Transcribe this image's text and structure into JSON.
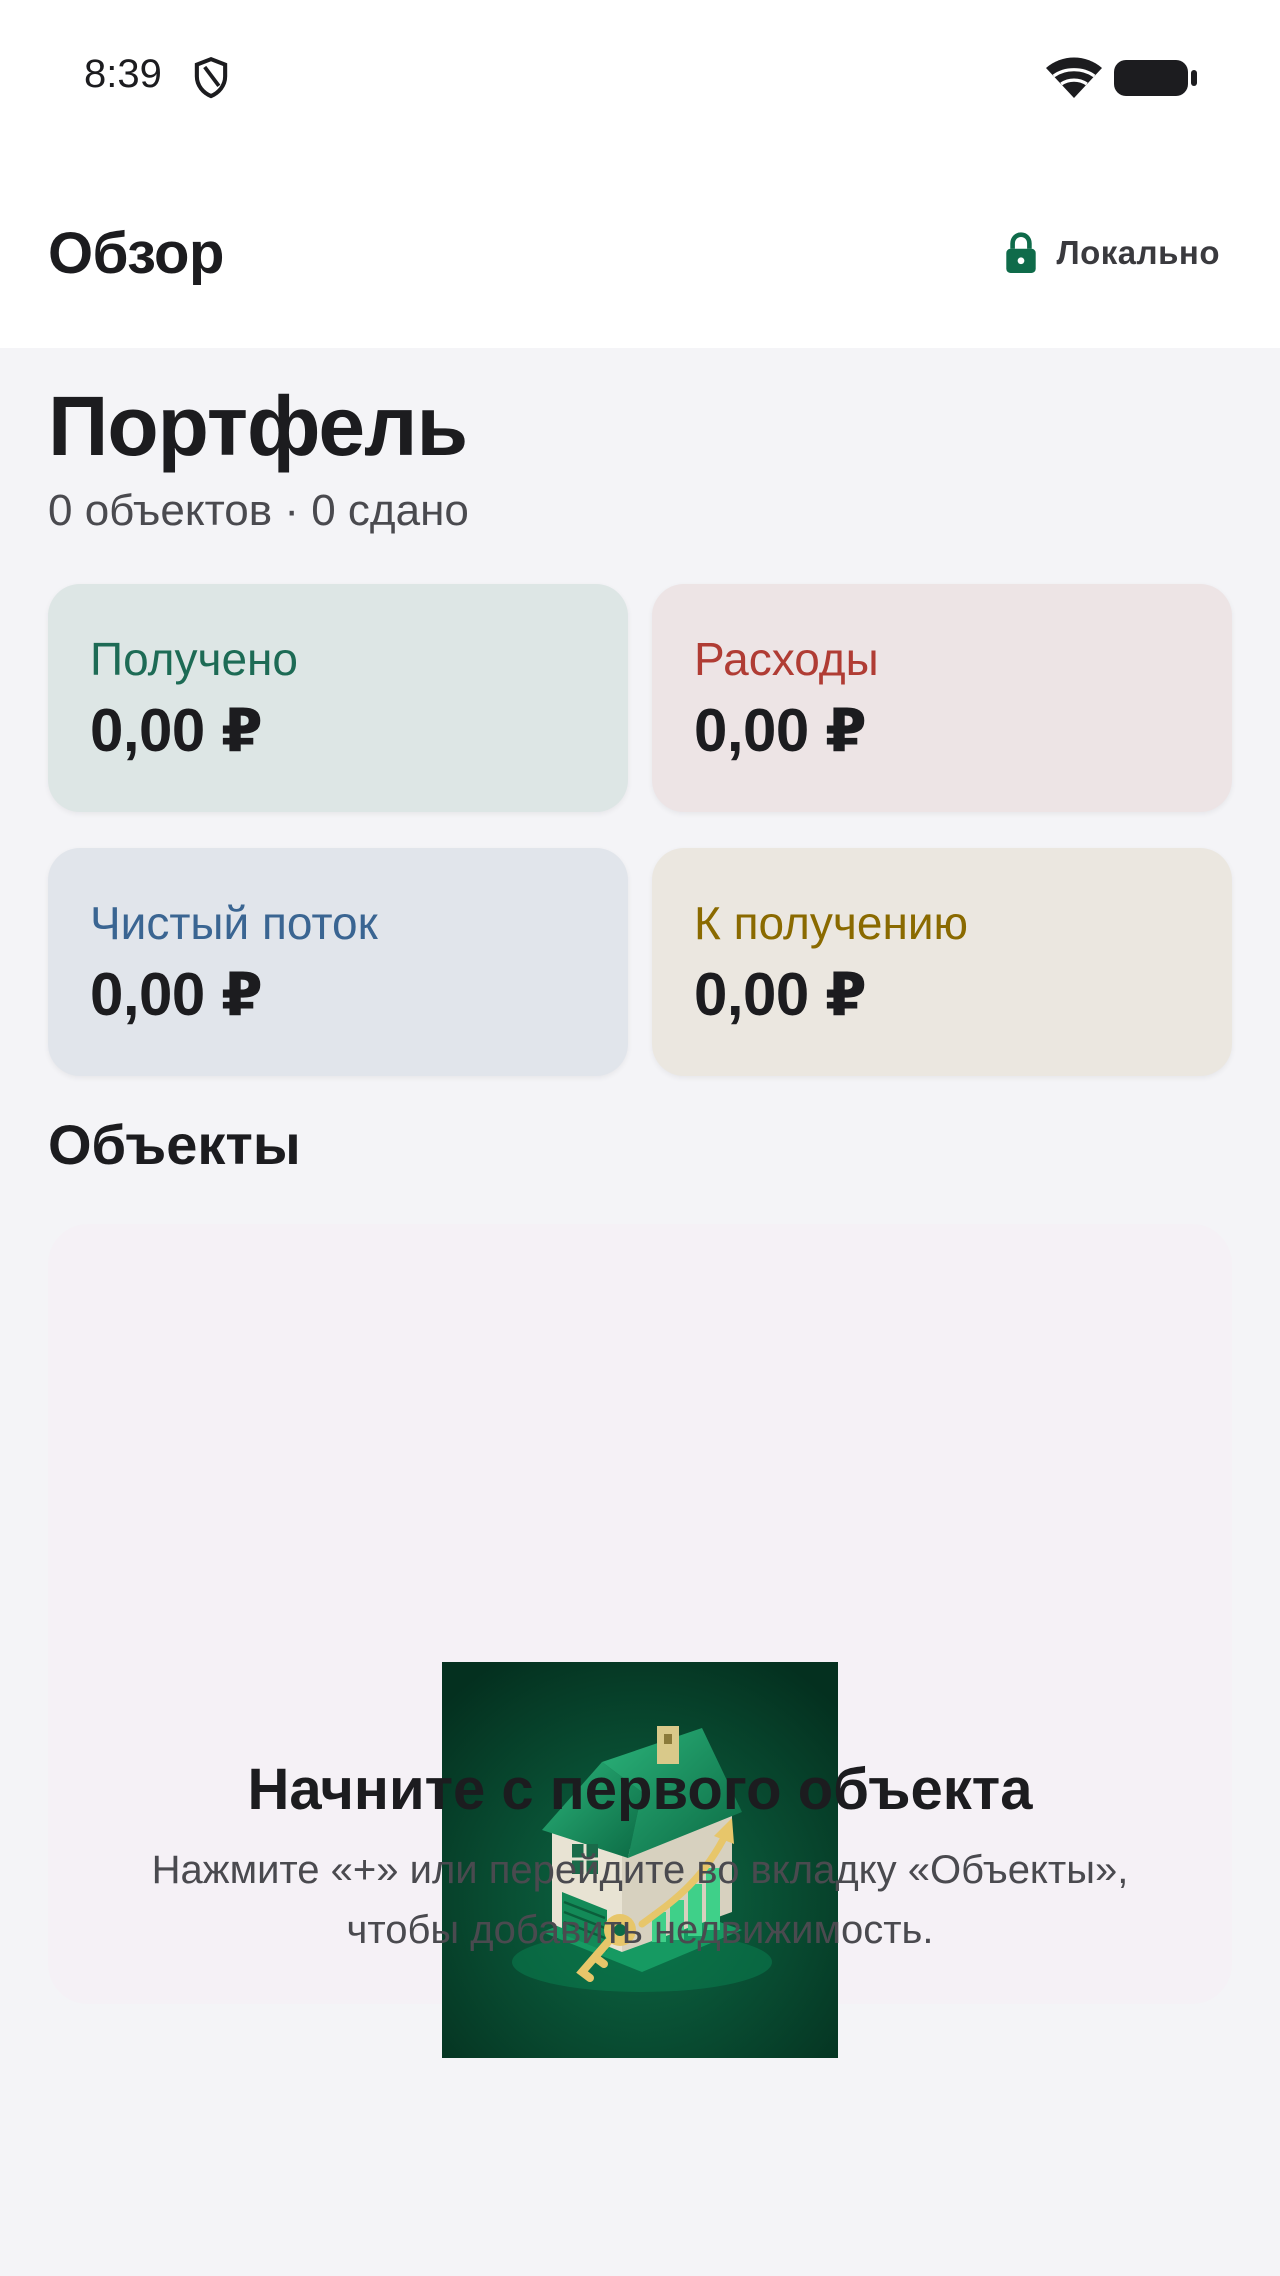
{
  "status_bar": {
    "time": "8:39",
    "icons": [
      "shield-icon",
      "wifi-icon",
      "battery-icon"
    ]
  },
  "app_bar": {
    "title": "Обзор",
    "storage_label": "Локально",
    "storage_icon": "lock-icon",
    "accent_color": "#0f6b4a"
  },
  "portfolio": {
    "title": "Портфель",
    "subtitle": "0 объектов · 0 сдано"
  },
  "stats": [
    {
      "label": "Получено",
      "value": "0,00 ₽",
      "color": "#1d6b55"
    },
    {
      "label": "Расходы",
      "value": "0,00 ₽",
      "color": "#b03c34"
    },
    {
      "label": "Чистый поток",
      "value": "0,00 ₽",
      "color": "#3a6592"
    },
    {
      "label": "К получению",
      "value": "0,00 ₽",
      "color": "#8a6a00"
    }
  ],
  "objects": {
    "title": "Объекты",
    "empty_state": {
      "illustration": "house-with-key-and-growth-chart",
      "title": "Начните с первого объекта",
      "text": "Нажмите «+» или перейдите во вкладку «Объекты», чтобы добавить недвижимость."
    }
  }
}
